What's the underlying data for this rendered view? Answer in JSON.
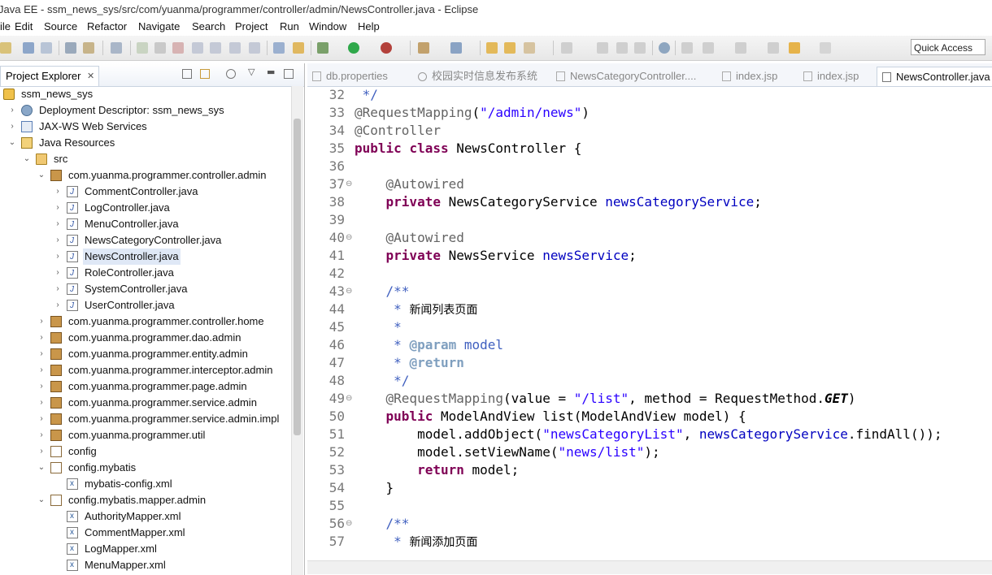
{
  "window": {
    "title": "Java EE - ssm_news_sys/src/com/yuanma/programmer/controller/admin/NewsController.java - Eclipse"
  },
  "menu": [
    "File",
    "Edit",
    "Source",
    "Refactor",
    "Navigate",
    "Search",
    "Project",
    "Run",
    "Window",
    "Help"
  ],
  "toolbar": {
    "quick_access": "Quick Access"
  },
  "explorer": {
    "title": "Project Explorer",
    "tree": [
      {
        "label": "ssm_news_sys",
        "icon": "project-icon",
        "depth": 0,
        "arrow": ""
      },
      {
        "label": "Deployment Descriptor: ssm_news_sys",
        "icon": "deployment-descriptor-icon",
        "depth": 1,
        "arrow": ">"
      },
      {
        "label": "JAX-WS Web Services",
        "icon": "web-services-icon",
        "depth": 1,
        "arrow": ">"
      },
      {
        "label": "Java Resources",
        "icon": "java-resources-icon",
        "depth": 1,
        "arrow": "v"
      },
      {
        "label": "src",
        "icon": "source-folder-icon",
        "depth": 2,
        "arrow": "v"
      },
      {
        "label": "com.yuanma.programmer.controller.admin",
        "icon": "package-icon",
        "depth": 3,
        "arrow": "v"
      },
      {
        "label": "CommentController.java",
        "icon": "java-file-icon",
        "depth": 4,
        "arrow": ">"
      },
      {
        "label": "LogController.java",
        "icon": "java-file-icon",
        "depth": 4,
        "arrow": ">"
      },
      {
        "label": "MenuController.java",
        "icon": "java-file-icon",
        "depth": 4,
        "arrow": ">"
      },
      {
        "label": "NewsCategoryController.java",
        "icon": "java-file-icon",
        "depth": 4,
        "arrow": ">"
      },
      {
        "label": "NewsController.java",
        "icon": "java-file-icon",
        "depth": 4,
        "arrow": ">",
        "selected": true
      },
      {
        "label": "RoleController.java",
        "icon": "java-file-icon",
        "depth": 4,
        "arrow": ">"
      },
      {
        "label": "SystemController.java",
        "icon": "java-file-icon",
        "depth": 4,
        "arrow": ">"
      },
      {
        "label": "UserController.java",
        "icon": "java-file-icon",
        "depth": 4,
        "arrow": ">"
      },
      {
        "label": "com.yuanma.programmer.controller.home",
        "icon": "package-icon",
        "depth": 3,
        "arrow": ">"
      },
      {
        "label": "com.yuanma.programmer.dao.admin",
        "icon": "package-icon",
        "depth": 3,
        "arrow": ">"
      },
      {
        "label": "com.yuanma.programmer.entity.admin",
        "icon": "package-icon",
        "depth": 3,
        "arrow": ">"
      },
      {
        "label": "com.yuanma.programmer.interceptor.admin",
        "icon": "package-icon",
        "depth": 3,
        "arrow": ">"
      },
      {
        "label": "com.yuanma.programmer.page.admin",
        "icon": "package-icon",
        "depth": 3,
        "arrow": ">"
      },
      {
        "label": "com.yuanma.programmer.service.admin",
        "icon": "package-icon",
        "depth": 3,
        "arrow": ">"
      },
      {
        "label": "com.yuanma.programmer.service.admin.impl",
        "icon": "package-icon",
        "depth": 3,
        "arrow": ">"
      },
      {
        "label": "com.yuanma.programmer.util",
        "icon": "package-icon",
        "depth": 3,
        "arrow": ">"
      },
      {
        "label": "config",
        "icon": "empty-package-icon",
        "depth": 3,
        "arrow": ">"
      },
      {
        "label": "config.mybatis",
        "icon": "empty-package-icon",
        "depth": 3,
        "arrow": "v"
      },
      {
        "label": "mybatis-config.xml",
        "icon": "xml-file-icon",
        "depth": 4,
        "arrow": ""
      },
      {
        "label": "config.mybatis.mapper.admin",
        "icon": "empty-package-icon",
        "depth": 3,
        "arrow": "v"
      },
      {
        "label": "AuthorityMapper.xml",
        "icon": "xml-file-icon",
        "depth": 4,
        "arrow": ""
      },
      {
        "label": "CommentMapper.xml",
        "icon": "xml-file-icon",
        "depth": 4,
        "arrow": ""
      },
      {
        "label": "LogMapper.xml",
        "icon": "xml-file-icon",
        "depth": 4,
        "arrow": ""
      },
      {
        "label": "MenuMapper.xml",
        "icon": "xml-file-icon",
        "depth": 4,
        "arrow": ""
      }
    ]
  },
  "editor": {
    "tabs": [
      {
        "label": "db.properties",
        "icon": "properties-file-icon"
      },
      {
        "label": "校园实时信息发布系统",
        "icon": "web-browser-icon"
      },
      {
        "label": "NewsCategoryController....",
        "icon": "java-file-icon"
      },
      {
        "label": "index.jsp",
        "icon": "jsp-file-icon"
      },
      {
        "label": "index.jsp",
        "icon": "jsp-file-icon"
      },
      {
        "label": "NewsController.java",
        "icon": "java-file-icon",
        "active": true
      }
    ],
    "lines": [
      {
        "n": "32",
        "fold": "",
        "tokens": [
          [
            "cm",
            " */"
          ]
        ]
      },
      {
        "n": "33",
        "fold": "",
        "tokens": [
          [
            "anno",
            "@RequestMapping"
          ],
          [
            "",
            "("
          ],
          [
            "str",
            "\"/admin/news\""
          ],
          [
            "",
            ")"
          ]
        ]
      },
      {
        "n": "34",
        "fold": "",
        "tokens": [
          [
            "anno",
            "@Controller"
          ]
        ]
      },
      {
        "n": "35",
        "fold": "",
        "tokens": [
          [
            "kw",
            "public"
          ],
          [
            "",
            " "
          ],
          [
            "kw",
            "class"
          ],
          [
            "",
            " NewsController {"
          ]
        ]
      },
      {
        "n": "36",
        "fold": "",
        "tokens": []
      },
      {
        "n": "37",
        "fold": "⊖",
        "tokens": [
          [
            "",
            "    "
          ],
          [
            "anno",
            "@Autowired"
          ]
        ]
      },
      {
        "n": "38",
        "fold": "",
        "tokens": [
          [
            "",
            "    "
          ],
          [
            "kw",
            "private"
          ],
          [
            "",
            " NewsCategoryService "
          ],
          [
            "field",
            "newsCategoryService"
          ],
          [
            "",
            ";"
          ]
        ]
      },
      {
        "n": "39",
        "fold": "",
        "tokens": []
      },
      {
        "n": "40",
        "fold": "⊖",
        "tokens": [
          [
            "",
            "    "
          ],
          [
            "anno",
            "@Autowired"
          ]
        ]
      },
      {
        "n": "41",
        "fold": "",
        "tokens": [
          [
            "",
            "    "
          ],
          [
            "kw",
            "private"
          ],
          [
            "",
            " NewsService "
          ],
          [
            "field",
            "newsService"
          ],
          [
            "",
            ";"
          ]
        ]
      },
      {
        "n": "42",
        "fold": "",
        "tokens": []
      },
      {
        "n": "43",
        "fold": "⊖",
        "tokens": [
          [
            "",
            "    "
          ],
          [
            "cm",
            "/**"
          ]
        ]
      },
      {
        "n": "44",
        "fold": "",
        "tokens": [
          [
            "",
            "     "
          ],
          [
            "cm",
            "* "
          ],
          [
            "cmtxt",
            "新闻列表页面"
          ]
        ]
      },
      {
        "n": "45",
        "fold": "",
        "tokens": [
          [
            "",
            "     "
          ],
          [
            "cm",
            "*"
          ]
        ]
      },
      {
        "n": "46",
        "fold": "",
        "tokens": [
          [
            "",
            "     "
          ],
          [
            "cm",
            "* "
          ],
          [
            "cmtag",
            "@param"
          ],
          [
            "cm",
            " model"
          ]
        ]
      },
      {
        "n": "47",
        "fold": "",
        "tokens": [
          [
            "",
            "     "
          ],
          [
            "cm",
            "* "
          ],
          [
            "cmtag",
            "@return"
          ]
        ]
      },
      {
        "n": "48",
        "fold": "",
        "tokens": [
          [
            "",
            "     "
          ],
          [
            "cm",
            "*/"
          ]
        ]
      },
      {
        "n": "49",
        "fold": "⊖",
        "tokens": [
          [
            "",
            "    "
          ],
          [
            "anno",
            "@RequestMapping"
          ],
          [
            "",
            "(value = "
          ],
          [
            "str",
            "\"/list\""
          ],
          [
            "",
            ", method = RequestMethod."
          ],
          [
            "bi",
            "GET"
          ],
          [
            "",
            ")"
          ]
        ]
      },
      {
        "n": "50",
        "fold": "",
        "tokens": [
          [
            "",
            "    "
          ],
          [
            "kw",
            "public"
          ],
          [
            "",
            " ModelAndView list(ModelAndView model) {"
          ]
        ]
      },
      {
        "n": "51",
        "fold": "",
        "tokens": [
          [
            "",
            "        model.addObject("
          ],
          [
            "str",
            "\"newsCategoryList\""
          ],
          [
            "",
            ", "
          ],
          [
            "field",
            "newsCategoryService"
          ],
          [
            "",
            ".findAll());"
          ]
        ]
      },
      {
        "n": "52",
        "fold": "",
        "tokens": [
          [
            "",
            "        model.setViewName("
          ],
          [
            "str",
            "\"news/list\""
          ],
          [
            "",
            ");"
          ]
        ]
      },
      {
        "n": "53",
        "fold": "",
        "tokens": [
          [
            "",
            "        "
          ],
          [
            "kw",
            "return"
          ],
          [
            "",
            " model;"
          ]
        ]
      },
      {
        "n": "54",
        "fold": "",
        "tokens": [
          [
            "",
            "    }"
          ]
        ]
      },
      {
        "n": "55",
        "fold": "",
        "tokens": []
      },
      {
        "n": "56",
        "fold": "⊖",
        "tokens": [
          [
            "",
            "    "
          ],
          [
            "cm",
            "/**"
          ]
        ]
      },
      {
        "n": "57",
        "fold": "",
        "tokens": [
          [
            "",
            "     "
          ],
          [
            "cm",
            "* "
          ],
          [
            "cmtxt",
            "新闻添加页面"
          ]
        ]
      }
    ]
  },
  "colors": {
    "keyword": "#7f0055",
    "string": "#2a00ff",
    "field": "#0000c0",
    "annotation": "#646464",
    "comment": "#3f5fbf",
    "selection": "#dfe8f6"
  }
}
